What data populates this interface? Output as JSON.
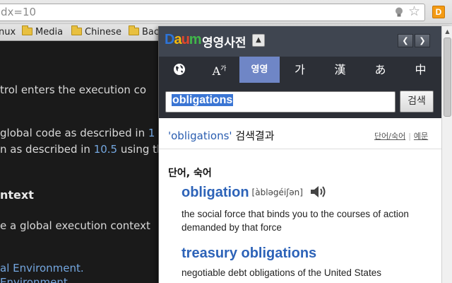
{
  "browser": {
    "url_text": "dx=10",
    "extension_label": "D",
    "bookmarks": [
      {
        "label": "nux"
      },
      {
        "label": "Media"
      },
      {
        "label": "Chinese"
      },
      {
        "label": "Bac"
      }
    ]
  },
  "page": {
    "lines": [
      {
        "text": "trol enters the execution co"
      },
      {
        "text_before": " global code as described in ",
        "link": "1"
      },
      {
        "text_before": "n as described in ",
        "link": "10.5",
        "text_after": " using th"
      },
      {
        "heading": "ntext"
      },
      {
        "text": "e a global execution context"
      },
      {
        "link": "al Environment."
      },
      {
        "link": "Environment"
      }
    ]
  },
  "popup": {
    "logo": {
      "letters": [
        "D",
        "a",
        "u",
        "m"
      ],
      "colors": [
        "#2d74d9",
        "#f5b90c",
        "#e0452d",
        "#41b64a"
      ]
    },
    "title": "영영사전",
    "tabs": [
      {
        "label": "🌐",
        "icon": "globe-icon"
      },
      {
        "label": "Aᵃᵏ",
        "icon": "font-icon"
      },
      {
        "label": "영영",
        "active": true
      },
      {
        "label": "가"
      },
      {
        "label": "漢"
      },
      {
        "label": "あ"
      },
      {
        "label": "中"
      }
    ],
    "search": {
      "value": "obligations",
      "button": "검색"
    },
    "result": {
      "query": "obligations",
      "suffix": " 검색결과",
      "links": [
        "단어/숙어",
        "예문"
      ]
    },
    "section_title": "단어, 숙어",
    "entries": [
      {
        "word": "obligation",
        "pron": "[àbləgéiʃən]",
        "definition": "the social force that binds you to the courses of action demanded by that force"
      },
      {
        "word": "treasury obligations",
        "pron": "",
        "definition": "negotiable debt obligations of the United States"
      }
    ],
    "accent_color": "#6f86c6",
    "word_color": "#2d63b8"
  }
}
